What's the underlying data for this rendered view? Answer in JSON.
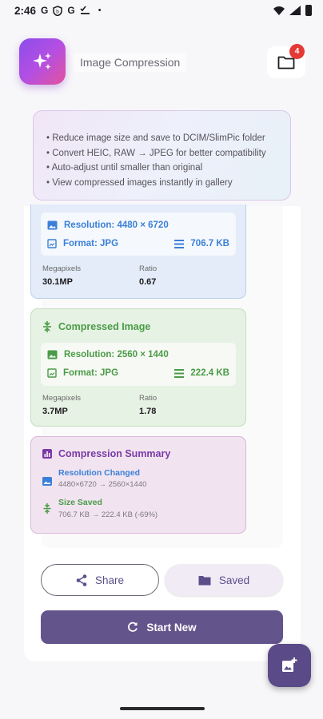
{
  "status_bar": {
    "time": "2:46",
    "notification_icons": [
      "google-g-icon",
      "shield-icon",
      "google-g-icon",
      "checklist-icon"
    ],
    "dot": "•"
  },
  "header": {
    "title": "Image Compression",
    "badge_count": "4",
    "logo_icon": "sparkles-icon",
    "folder_icon": "folder-icon"
  },
  "info": {
    "lines": [
      "• Reduce image size and save to DCIM/SlimPic folder",
      "• Convert HEIC, RAW → JPEG for better compatibility",
      "• Auto-adjust until smaller than original",
      "• View compressed images instantly in gallery"
    ]
  },
  "original": {
    "resolution": "Resolution: 4480 × 6720",
    "format": "Format: JPG",
    "size": "706.7 KB",
    "megapixels_label": "Megapixels",
    "megapixels_value": "30.1MP",
    "ratio_label": "Ratio",
    "ratio_value": "0.67"
  },
  "compressed": {
    "title": "Compressed Image",
    "resolution": "Resolution: 2560 × 1440",
    "format": "Format: JPG",
    "size": "222.4 KB",
    "megapixels_label": "Megapixels",
    "megapixels_value": "3.7MP",
    "ratio_label": "Ratio",
    "ratio_value": "1.78"
  },
  "summary": {
    "title": "Compression Summary",
    "resolution_changed_title": "Resolution Changed",
    "resolution_changed_detail": "4480×6720 → 2560×1440",
    "size_saved_title": "Size Saved",
    "size_saved_detail": "706.7 KB → 222.4 KB (-69%)"
  },
  "actions": {
    "share": "Share",
    "saved": "Saved",
    "start_new": "Start New"
  },
  "colors": {
    "accent": "#64548c",
    "original": "#3b80d8",
    "compressed": "#4b9b47",
    "summary": "#7b3aa6",
    "badge": "#e53935"
  }
}
